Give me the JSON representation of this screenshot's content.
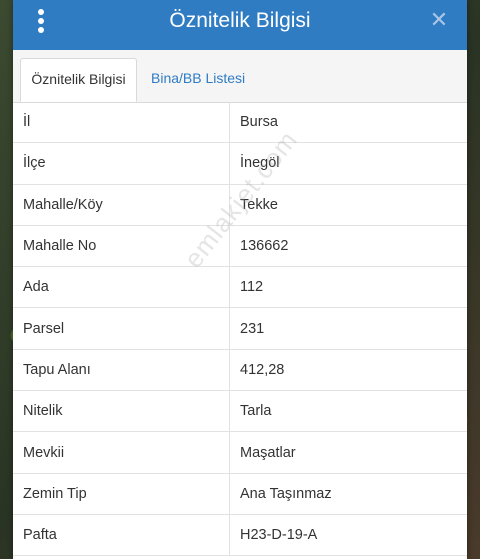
{
  "header": {
    "title": "Öznitelik Bilgisi"
  },
  "tabs": [
    {
      "label": "Öznitelik Bilgisi",
      "active": true
    },
    {
      "label": "Bina/BB Listesi",
      "active": false
    }
  ],
  "rows": [
    {
      "key": "İl",
      "value": "Bursa"
    },
    {
      "key": "İlçe",
      "value": "İnegöl"
    },
    {
      "key": "Mahalle/Köy",
      "value": "Tekke"
    },
    {
      "key": "Mahalle No",
      "value": "136662"
    },
    {
      "key": "Ada",
      "value": "112"
    },
    {
      "key": "Parsel",
      "value": "231"
    },
    {
      "key": "Tapu Alanı",
      "value": "412,28"
    },
    {
      "key": "Nitelik",
      "value": "Tarla"
    },
    {
      "key": "Mevkii",
      "value": "Maşatlar"
    },
    {
      "key": "Zemin Tip",
      "value": "Ana Taşınmaz"
    },
    {
      "key": "Pafta",
      "value": "H23-D-19-A"
    }
  ],
  "watermark": "emlakjet.com",
  "colors": {
    "header": "#2f7cc3",
    "tab_link": "#2f7cc3"
  }
}
